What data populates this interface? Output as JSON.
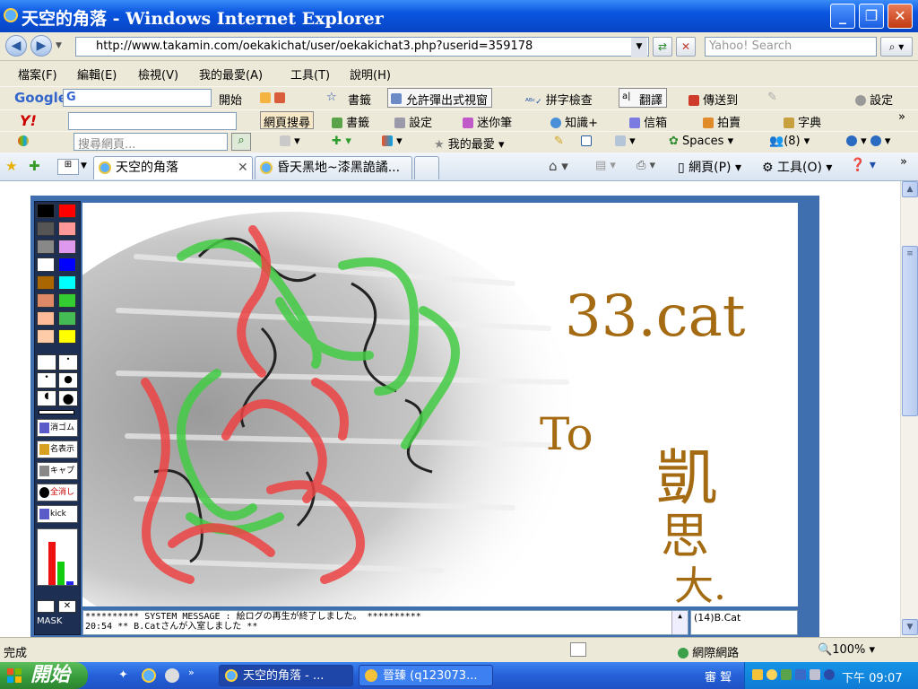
{
  "window": {
    "title": "天空的角落 - Windows Internet Explorer",
    "minimize": "_",
    "maximize": "❐",
    "close": "✕"
  },
  "address": {
    "url": "http://www.takamin.com/oekakichat/user/oekakichat3.php?userid=359178",
    "search_placeholder": "Yahoo! Search"
  },
  "menu": [
    "檔案(F)",
    "編輯(E)",
    "檢視(V)",
    "我的最愛(A)",
    "工具(T)",
    "說明(H)"
  ],
  "google_toolbar": {
    "brand": "Google",
    "search_prefix": "G",
    "items": [
      "開始",
      "書籤",
      "允許彈出式視窗",
      "拼字檢查",
      "翻譯",
      "傳送到",
      "設定"
    ]
  },
  "yahoo_toolbar": {
    "brand": "Y!",
    "items": [
      "網頁搜尋",
      "書籤",
      "設定",
      "迷你筆",
      "知識+",
      "信箱",
      "拍賣",
      "字典"
    ]
  },
  "msn_toolbar": {
    "search_placeholder": "搜尋網頁...",
    "items": [
      "我的最愛",
      "Spaces",
      "(8)"
    ]
  },
  "tabs": [
    {
      "label": "天空的角落",
      "active": true
    },
    {
      "label": "昏天黑地~漆黑詭譎...",
      "active": false
    }
  ],
  "command_bar": [
    "網頁(P)",
    "工具(O)"
  ],
  "oekaki": {
    "buttons": [
      "消ゴム",
      "名表示",
      "キャプ",
      "全消し",
      "kick"
    ],
    "mask_label": "MASK",
    "palette_colors": [
      "#000000",
      "#ff0000",
      "#555555",
      "#ff9999",
      "#888888",
      "#dd99ee",
      "#ffffff",
      "#0000ff",
      "#aa6600",
      "#00ffff",
      "#dd8866",
      "#33cc33",
      "#ffbb99",
      "#44bb55",
      "#ffccaa",
      "#ffff00"
    ],
    "chat_log": [
      "********** SYSTEM MESSAGE : 絵ログの再生が終了しました。 **********",
      "20:54 ** B.Catさんが入室しました **"
    ],
    "user_list": [
      "(14)B.Cat"
    ],
    "drawing_text": {
      "line1": "33.cat",
      "line2": "To",
      "name": [
        "凱",
        "思",
        "大."
      ]
    }
  },
  "status": {
    "left": "完成",
    "zone": "網際網路",
    "zoom": "100%"
  },
  "taskbar": {
    "start": "開始",
    "tasks": [
      {
        "label": "天空的角落 - ...",
        "active": true
      },
      {
        "label": "晉臻 (q123073...",
        "active": false
      }
    ],
    "clock": "下午 09:07",
    "tray_text": "審 聟"
  }
}
